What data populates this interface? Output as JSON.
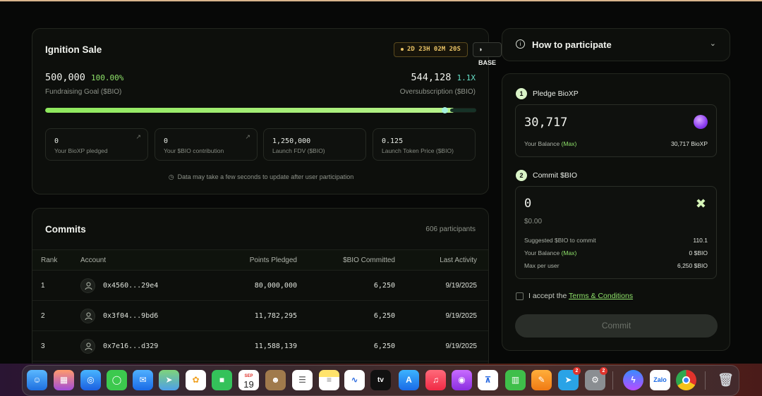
{
  "ignition": {
    "title": "Ignition Sale",
    "timer": "2D 23H 02M 20S",
    "chain": "BASE",
    "goal_value": "500,000",
    "goal_percent": "100.00%",
    "goal_label": "Fundraising Goal ($BIO)",
    "oversub_value": "544,128",
    "oversub_mult": "1.1X",
    "oversub_label": "Oversubscription ($BIO)",
    "progress_fraction": 0.95,
    "stats": [
      {
        "value": "0",
        "label": "Your BioXP pledged"
      },
      {
        "value": "0",
        "label": "Your $BIO contribution"
      },
      {
        "value": "1,250,000",
        "label": "Launch FDV ($BIO)"
      },
      {
        "value": "0.125",
        "label": "Launch Token Price ($BIO)"
      }
    ],
    "note": "Data may take a few seconds to update after user participation"
  },
  "commits": {
    "title": "Commits",
    "participants": "606 participants",
    "headers": [
      "Rank",
      "Account",
      "Points Pledged",
      "$BIO Committed",
      "Last Activity"
    ],
    "rows": [
      {
        "rank": "1",
        "account": "0x4560...29e4",
        "points": "80,000,000",
        "bio": "6,250",
        "date": "9/19/2025"
      },
      {
        "rank": "2",
        "account": "0x3f04...9bd6",
        "points": "11,782,295",
        "bio": "6,250",
        "date": "9/19/2025"
      },
      {
        "rank": "3",
        "account": "0x7e16...d329",
        "points": "11,588,139",
        "bio": "6,250",
        "date": "9/19/2025"
      }
    ]
  },
  "howto": {
    "title": "How to participate"
  },
  "participate": {
    "step1_num": "1",
    "step1_label": "Pledge BioXP",
    "pledge_value": "30,717",
    "balance_label": "Your Balance",
    "max_label": "(Max)",
    "balance_value": "30,717 BioXP",
    "step2_num": "2",
    "step2_label": "Commit $BIO",
    "commit_value": "0",
    "commit_usd": "$0.00",
    "suggested_label": "Suggested $BIO to commit",
    "suggested_value": "110.1",
    "balance2_label": "Your Balance",
    "balance2_max": "(Max)",
    "balance2_value": "0 $BIO",
    "maxper_label": "Max per user",
    "maxper_value": "6,250 $BIO",
    "accept_prefix": "I accept the",
    "terms_link": "Terms & Conditions",
    "commit_button": "Commit"
  },
  "dock": {
    "calendar_month": "SEP",
    "calendar_day": "19",
    "tv_label": "tv",
    "zalo_label": "Zalo",
    "telegram_badge": "2",
    "settings_badge": "2"
  }
}
